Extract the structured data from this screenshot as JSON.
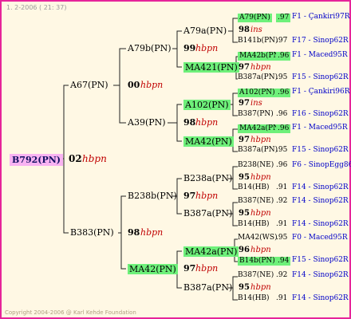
{
  "header": {
    "date": "1.  2-2006 ( 21: 37)"
  },
  "footer": {
    "copyright": "Copyright 2004-2006 @ Karl Kehde Foundation"
  },
  "colors": {
    "border": "#e6249a",
    "highlight": "#6ef07a",
    "root": "#f9b3f2",
    "breeder": "#c00000",
    "location": "#0000c8"
  },
  "root": {
    "name": "B792(PN)",
    "drone_count": "02",
    "breeder": "hbpn"
  },
  "gen1": [
    {
      "name": "A67(PN)",
      "count": "00",
      "breeder": "hbpn"
    },
    {
      "name": "B383(PN)",
      "count": "98",
      "breeder": "hbpn"
    }
  ],
  "gen2": [
    {
      "name": "A79b(PN)"
    },
    {
      "name": "A39(PN)"
    },
    {
      "name": "B238b(PN)"
    },
    {
      "name": "MA42(PN)"
    }
  ],
  "gen3": [
    {
      "name": "A79a(PN)",
      "count": "99",
      "breeder": "hbpn"
    },
    {
      "name": "MA421(PN)"
    },
    {
      "name": "A102(PN)",
      "count": "98",
      "breeder": "hbpn"
    },
    {
      "name": "MA42(PN)"
    },
    {
      "name": "B238a(PN)",
      "count": "97",
      "breeder": "hbpn"
    },
    {
      "name": "B387a(PN)"
    },
    {
      "name": "MA42a(PN)",
      "count": "97",
      "breeder": "hbpn"
    },
    {
      "name": "B387a(PN)"
    }
  ],
  "gen4": [
    {
      "name": "A79(PN)",
      "score": ".97",
      "loc": "F1 - Çankiri97R",
      "hl": true
    },
    {
      "count": "98",
      "breeder": "ins"
    },
    {
      "name": "B141b(PN)",
      "score": ".97",
      "loc": "F17 - Sinop62R"
    },
    {
      "name": "MA42b(PN)",
      "score": ".96",
      "loc": "F1 - Maced95R",
      "hl": true
    },
    {
      "count": "97",
      "breeder": "hbpn"
    },
    {
      "name": "B387a(PN)",
      "score": ".95",
      "loc": "F15 - Sinop62R"
    },
    {
      "name": "A102(PN)",
      "score": ".96",
      "loc": "F1 - Çankiri96R",
      "hl": true
    },
    {
      "count": "97",
      "breeder": "ins"
    },
    {
      "name": "B387(PN)",
      "score": ".96",
      "loc": "F16 - Sinop62R"
    },
    {
      "name": "MA42a(PN)",
      "score": ".96",
      "loc": "F1 - Maced95R",
      "hl": true
    },
    {
      "count": "97",
      "breeder": "hbpn"
    },
    {
      "name": "B387a(PN)",
      "score": ".95",
      "loc": "F15 - Sinop62R"
    },
    {
      "name": "B238(NE)",
      "score": ".96",
      "loc": "F6 - SinopEgg86R"
    },
    {
      "count": "95",
      "breeder": "hbpn"
    },
    {
      "name": "B14(HB)",
      "score": ".91",
      "loc": "F14 - Sinop62R"
    },
    {
      "name": "B387(NE)",
      "score": ".92",
      "loc": "F14 - Sinop62R"
    },
    {
      "count": "95",
      "breeder": "hbpn"
    },
    {
      "name": "B14(HB)",
      "score": ".91",
      "loc": "F14 - Sinop62R"
    },
    {
      "name": "MA42(WS)",
      "score": ".95",
      "loc": "F0 - Maced95R"
    },
    {
      "count": "96",
      "breeder": "hbpn"
    },
    {
      "name": "B14b(PN)",
      "score": ".94",
      "loc": "F15 - Sinop62R",
      "hl": true
    },
    {
      "name": "B387(NE)",
      "score": ".92",
      "loc": "F14 - Sinop62R"
    },
    {
      "count": "95",
      "breeder": "hbpn"
    },
    {
      "name": "B14(HB)",
      "score": ".91",
      "loc": "F14 - Sinop62R"
    }
  ]
}
